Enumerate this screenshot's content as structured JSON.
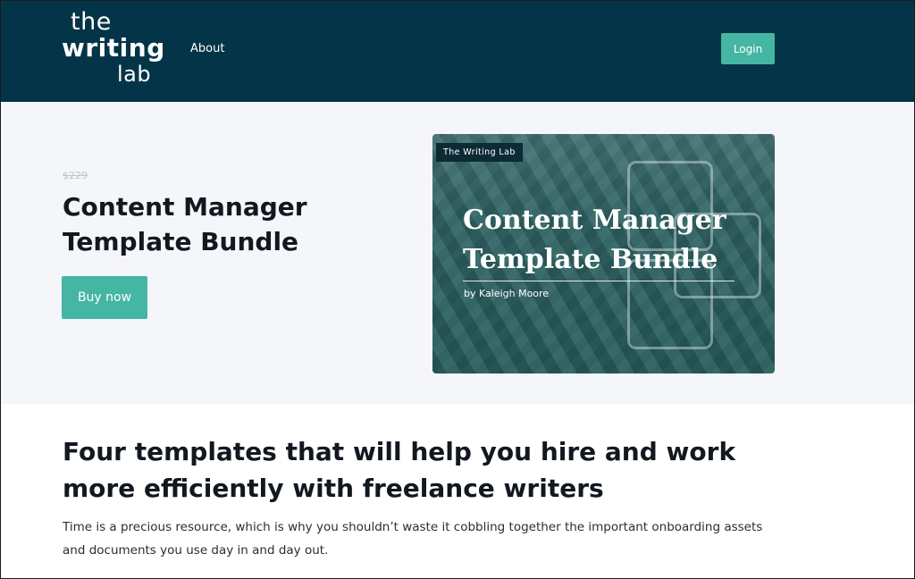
{
  "header": {
    "logo": {
      "line1": "the",
      "line2": "writing",
      "line3": "lab"
    },
    "nav": {
      "about": "About"
    },
    "login_label": "Login"
  },
  "hero": {
    "price_old": "$229",
    "title": "Content Manager Template Bundle",
    "buy_label": "Buy now",
    "cover": {
      "badge": "The Writing Lab",
      "title_line1": "Content Manager",
      "title_line2": "Template Bundle",
      "byline": "by Kaleigh Moore"
    }
  },
  "section": {
    "headline": "Four templates that will help you hire and work more efficiently with freelance writers",
    "description": "Time is a precious resource, which is why you shouldn’t waste it cobbling together the important onboarding assets and documents you use day in and day out."
  },
  "colors": {
    "header_bg": "#043447",
    "accent": "#45b5a4",
    "hero_bg": "#f5f6fa",
    "text_dark": "#111820"
  }
}
